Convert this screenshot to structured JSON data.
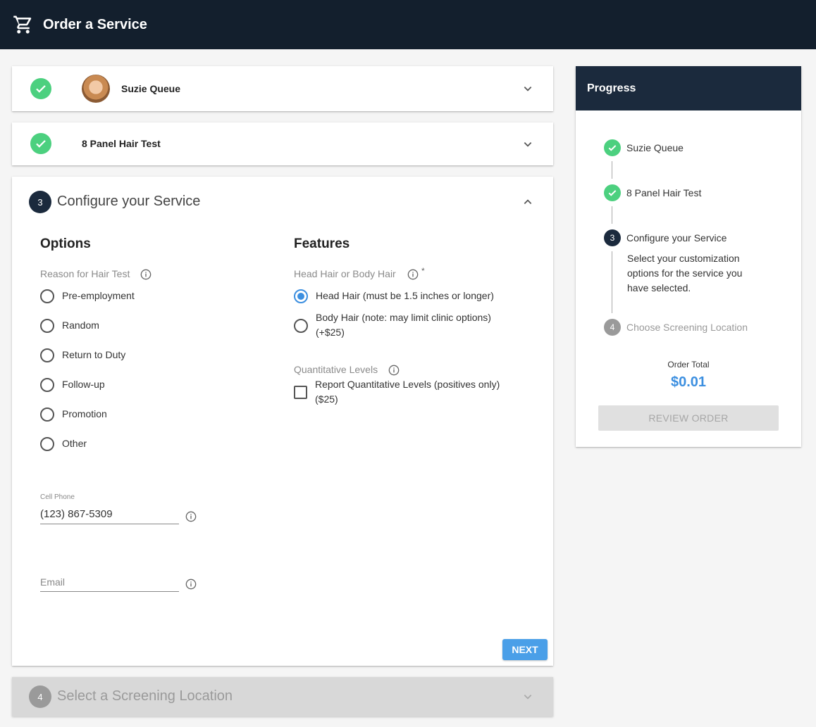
{
  "header": {
    "title": "Order a Service",
    "icon": "shopping-cart-icon"
  },
  "steps": {
    "step1": {
      "label": "Suzie Queue",
      "status": "complete"
    },
    "step2": {
      "label": "8 Panel Hair Test",
      "status": "complete"
    },
    "step3": {
      "number": "3",
      "title": "Configure your Service",
      "options": {
        "heading": "Options",
        "reason_label": "Reason for Hair Test",
        "reasons": [
          {
            "label": "Pre-employment",
            "selected": false
          },
          {
            "label": "Random",
            "selected": false
          },
          {
            "label": "Return to Duty",
            "selected": false
          },
          {
            "label": "Follow-up",
            "selected": false
          },
          {
            "label": "Promotion",
            "selected": false
          },
          {
            "label": "Other",
            "selected": false
          }
        ],
        "cell_phone": {
          "label": "Cell Phone",
          "value": "(123) 867-5309"
        },
        "email": {
          "placeholder": "Email",
          "value": ""
        }
      },
      "features": {
        "heading": "Features",
        "hair_label": "Head Hair or Body Hair",
        "required_mark": "*",
        "hair_options": [
          {
            "label": "Head Hair (must be 1.5 inches or longer)",
            "selected": true
          },
          {
            "label": "Body Hair (note: may limit clinic options) (+$25)",
            "selected": false
          }
        ],
        "quant_label": "Quantitative Levels",
        "quant_option": {
          "label": "Report Quantitative Levels (positives only) ($25)",
          "checked": false
        }
      },
      "next_label": "NEXT"
    },
    "step4": {
      "number": "4",
      "title": "Select a Screening Location",
      "status": "disabled"
    }
  },
  "progress": {
    "title": "Progress",
    "steps": [
      {
        "label": "Suzie Queue",
        "status": "complete"
      },
      {
        "label": "8 Panel Hair Test",
        "status": "complete"
      },
      {
        "number": "3",
        "label": "Configure your Service",
        "status": "current",
        "description": "Select your customization options for the service you have selected."
      },
      {
        "number": "4",
        "label": "Choose Screening Location",
        "status": "pending"
      }
    ],
    "order_total_label": "Order Total",
    "order_total": "$0.01",
    "review_label": "REVIEW ORDER"
  },
  "colors": {
    "header_bg": "#131f2d",
    "progress_header_bg": "#1b2a3d",
    "success": "#4cd07f",
    "accent": "#3c8fe0",
    "step_number_bg": "#1b2a3d",
    "disabled_bg": "#d8d8d8"
  }
}
